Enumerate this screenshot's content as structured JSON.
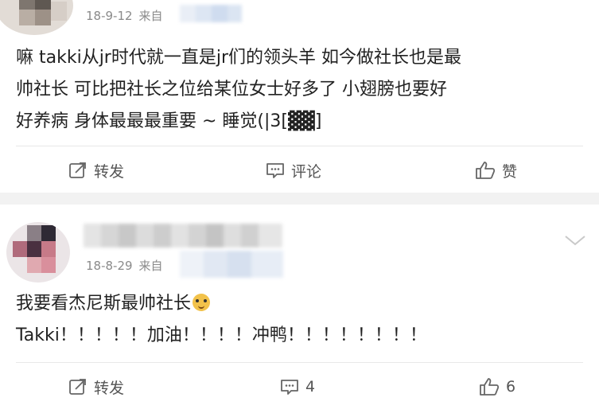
{
  "colors": {
    "background": "#f2f2f2",
    "card": "#ffffff",
    "meta_text": "#8a8a8a",
    "body_text": "#222222",
    "action_text": "#555555",
    "divider": "#e8e8e8"
  },
  "comments": [
    {
      "date": "18-9-12",
      "source_prefix": "来自",
      "text_lines": [
        "嘛 takki从jr时代就一直是jr们的领头羊 如今做社长也是最",
        "帅社长  可比把社长之位给某位女士好多了 小翅膀也要好",
        "好养病 身体最最最重要 ~   睡觉(|3[▓▓]"
      ],
      "actions": {
        "repost": "转发",
        "comment": "评论",
        "like": "赞"
      },
      "icons": [
        "repost-icon",
        "comment-icon",
        "like-icon"
      ]
    },
    {
      "date": "18-8-29",
      "source_prefix": "来自",
      "text_lines": [
        "我要看杰尼斯最帅社长",
        "Takki！！！！！加油！！！！冲鸭！！！！！！！！"
      ],
      "emoji": "doge-emoji-icon",
      "actions": {
        "repost": "转发",
        "comment": "4",
        "like": "6"
      },
      "icons": [
        "repost-icon",
        "comment-icon",
        "like-icon",
        "chevron-down-icon"
      ]
    }
  ]
}
